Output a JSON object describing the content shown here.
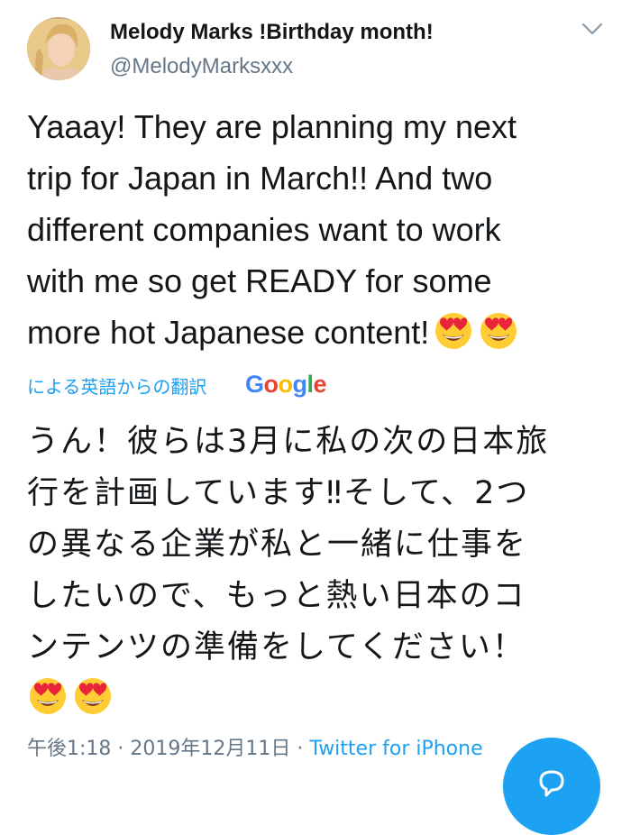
{
  "author": {
    "display_name": "Melody Marks !Birthday month!",
    "handle": "@MelodyMarksxxx"
  },
  "icons": {
    "avatar": "profile-photo",
    "menu": "chevron-down-icon",
    "emoji": "heart-eyes-emoji-icon",
    "fab": "compose-reply-icon"
  },
  "tweet": {
    "lines": [
      "Yaaay! They are planning my next",
      "trip for Japan in March!! And two",
      "different companies want to work",
      "with me so get READY for some",
      "more hot Japanese content!"
    ]
  },
  "translation": {
    "label": "による英語からの翻訳",
    "provider": "Google",
    "lines": [
      "うん！彼らは3月に私の次の日本旅",
      "行を計画しています‼そして、2つ",
      "の異なる企業が私と一緒に仕事を",
      "したいので、もっと熱い日本のコ",
      "ンテンツの準備をしてください！"
    ]
  },
  "meta": {
    "time": "午後1:18",
    "separator": "·",
    "date": "2019年12月11日",
    "source": "Twitter for iPhone"
  },
  "colors": {
    "accent": "#1da1f2",
    "secondary_text": "#657786",
    "primary_text": "#14171a",
    "google_blue": "#4285F4",
    "google_red": "#EA4335",
    "google_yellow": "#FBBC05",
    "google_green": "#34A853"
  }
}
